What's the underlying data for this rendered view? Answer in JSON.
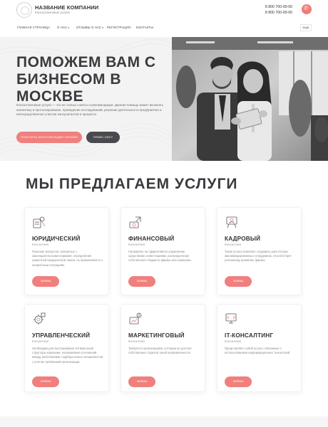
{
  "header": {
    "company_name": "НАЗВАНИЕ КОМПАНИИ",
    "company_sub": "Консалтинговые услуги",
    "phone1": "8 800 700-00-00",
    "phone2": "8 800 700-00-00",
    "phone_icon": "phone-icon"
  },
  "nav": {
    "items": [
      "ГЛАВНАЯ СТРАНИЦА",
      "О НАС",
      "ОТЗЫВЫ О НАС",
      "РЕГИСТРАЦИЯ",
      "КОНТАКТЫ"
    ],
    "button": "ЕЩЕ"
  },
  "hero": {
    "title_lines": [
      "ПОМОЖЕМ ВАМ С",
      "БИЗНЕСОМ В",
      "МОСКВЕ"
    ],
    "text": "Консалтинговые услуги — это не только советы и рекомендации. Данная помощь может включать аналитику и прогнозирование, проведение исследований, решение деятельности предприятия и непосредственное участие консультантов в процессе.",
    "button_primary": "ПОЛУЧИТЬ КОНСУЛЬТАЦИЮ ОНЛАЙН",
    "button_secondary": "ПРАЙС-ЛИСТ"
  },
  "services": {
    "title": "МЫ ПРЕДЛАГАЕМ УСЛУГИ",
    "cards": [
      {
        "title": "ЮРИДИЧЕСКИЙ",
        "sub": "Консалтинг",
        "desc": "Решение вопросов, связанных с законодательными нормами, определение грамотной юридической линии, их применимость к конкретным ситуациям.",
        "button": "ЗАЯВКА",
        "icon": "legal-icon"
      },
      {
        "title": "ФИНАНСОВЫЙ",
        "sub": "Консалтинг",
        "desc": "Направлен на эффективное управление средствами, инвестициями, распределение собственного бюджета фирмы или компании.",
        "button": "ЗАЯВКА",
        "icon": "finance-icon"
      },
      {
        "title": "КАДРОВЫЙ",
        "sub": "Консалтинг",
        "desc": "Такая услуга помогает создавать риск потери квалифицированных сотрудников, способствует успешному развитию фирмы.",
        "button": "ЗАЯВКА",
        "icon": "personnel-icon"
      },
      {
        "title": "УПРАВЛЕНЧЕСКИЙ",
        "sub": "Консалтинг",
        "desc": "Необходим для выстраивания оптимальной структуры компании, налаживания отношений между работниками, подбора новых специалистов с учетом требований организации.",
        "button": "ЗАЯВКА",
        "icon": "management-icon"
      },
      {
        "title": "МАРКЕТИНГОВЫЙ",
        "sub": "Консалтинг",
        "desc": "Требуется организациям, которым не достает собственных отделов такой направленности.",
        "button": "ЗАЯВКА",
        "icon": "marketing-icon"
      },
      {
        "title": "IT-КОНСАЛТИНГ",
        "sub": "Консалтинг",
        "desc": "Представляет собой услуги, связанные с использованием информационных технологий.",
        "button": "ЗАЯВКА",
        "icon": "it-icon"
      }
    ]
  },
  "colors": {
    "accent": "#f07f7d",
    "dark_button": "#4a4a4e",
    "text": "#3a3a3f"
  }
}
